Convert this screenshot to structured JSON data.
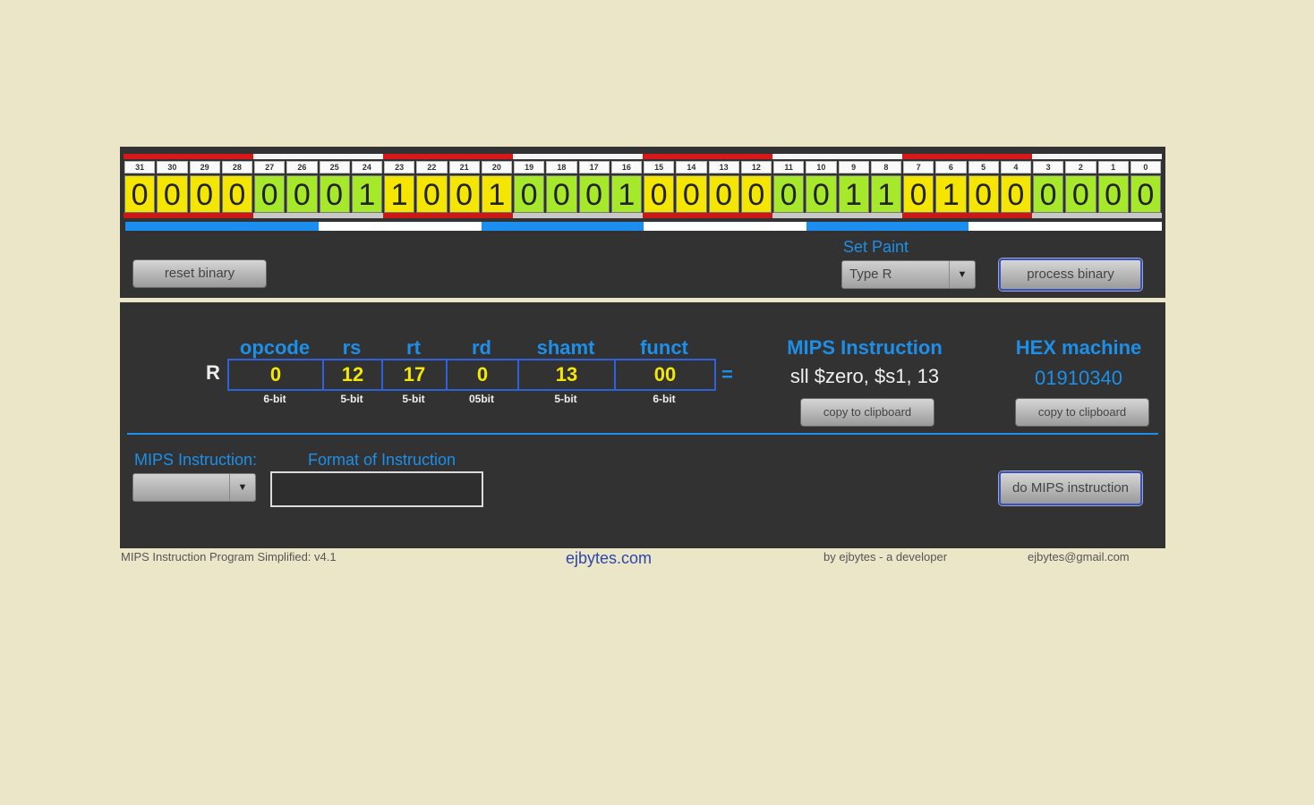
{
  "bits": {
    "numbers": [
      "31",
      "30",
      "29",
      "28",
      "27",
      "26",
      "25",
      "24",
      "23",
      "22",
      "21",
      "20",
      "19",
      "18",
      "17",
      "16",
      "15",
      "14",
      "13",
      "12",
      "11",
      "10",
      "9",
      "8",
      "7",
      "6",
      "5",
      "4",
      "3",
      "2",
      "1",
      "0"
    ],
    "values": [
      "0",
      "0",
      "0",
      "0",
      "0",
      "0",
      "0",
      "1",
      "1",
      "0",
      "0",
      "1",
      "0",
      "0",
      "0",
      "1",
      "0",
      "0",
      "0",
      "0",
      "0",
      "0",
      "1",
      "1",
      "0",
      "1",
      "0",
      "0",
      "0",
      "0",
      "0",
      "0"
    ]
  },
  "controls": {
    "reset_label": "reset binary",
    "set_paint_label": "Set Paint",
    "type_selected": "Type R",
    "process_label": "process binary"
  },
  "fields": {
    "row_label": "R",
    "items": [
      {
        "name": "opcode",
        "value": "0",
        "bits": "6-bit"
      },
      {
        "name": "rs",
        "value": "12",
        "bits": "5-bit"
      },
      {
        "name": "rt",
        "value": "17",
        "bits": "5-bit"
      },
      {
        "name": "rd",
        "value": "0",
        "bits": "05bit"
      },
      {
        "name": "shamt",
        "value": "13",
        "bits": "5-bit"
      },
      {
        "name": "funct",
        "value": "00",
        "bits": "6-bit"
      }
    ],
    "equals": "="
  },
  "mips": {
    "title": "MIPS Instruction",
    "value": "sll $zero, $s1, 13",
    "copy_label": "copy to clipboard"
  },
  "hex": {
    "title": "HEX machine",
    "value": "01910340",
    "copy_label": "copy to clipboard"
  },
  "lower": {
    "instruction_label": "MIPS Instruction:",
    "instruction_selected": "",
    "format_label": "Format of Instruction",
    "format_value": "",
    "do_label": "do MIPS instruction"
  },
  "footer": {
    "version": "MIPS Instruction Program Simplified: v4.1",
    "site": "ejbytes.com",
    "by": "by ejbytes - a developer",
    "email": "ejbytes@gmail.com"
  }
}
